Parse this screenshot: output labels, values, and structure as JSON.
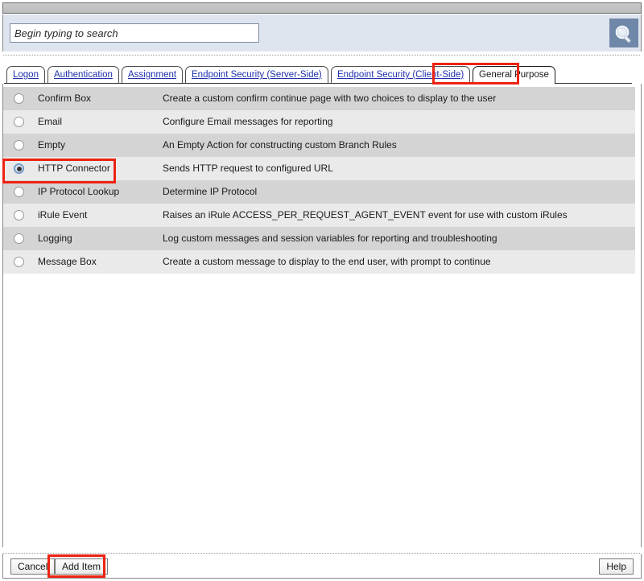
{
  "window": {
    "title_bar": ""
  },
  "search": {
    "placeholder": "Begin typing to search",
    "value": "",
    "button_icon": "search-icon"
  },
  "tabs": [
    {
      "label": "Logon",
      "active": false
    },
    {
      "label": "Authentication",
      "active": false
    },
    {
      "label": "Assignment",
      "active": false
    },
    {
      "label": "Endpoint Security (Server-Side)",
      "active": false
    },
    {
      "label": "Endpoint Security (Client-Side)",
      "active": false
    },
    {
      "label": "General Purpose",
      "active": true
    }
  ],
  "items": [
    {
      "name": "Confirm Box",
      "description": "Create a custom confirm continue page with two choices to display to the user",
      "selected": false
    },
    {
      "name": "Email",
      "description": "Configure Email messages for reporting",
      "selected": false
    },
    {
      "name": "Empty",
      "description": "An Empty Action for constructing custom Branch Rules",
      "selected": false
    },
    {
      "name": "HTTP Connector",
      "description": "Sends HTTP request to configured URL",
      "selected": true
    },
    {
      "name": "IP Protocol Lookup",
      "description": "Determine IP Protocol",
      "selected": false
    },
    {
      "name": "iRule Event",
      "description": "Raises an iRule ACCESS_PER_REQUEST_AGENT_EVENT event for use with custom iRules",
      "selected": false
    },
    {
      "name": "Logging",
      "description": "Log custom messages and session variables for reporting and troubleshooting",
      "selected": false
    },
    {
      "name": "Message Box",
      "description": "Create a custom message to display to the end user, with prompt to continue",
      "selected": false
    }
  ],
  "buttons": {
    "cancel": "Cancel",
    "add_item": "Add Item",
    "help": "Help"
  },
  "colors": {
    "annotation": "#ee2211",
    "row_odd": "#d4d4d4",
    "row_even": "#eaeaea",
    "search_band": "#dfe5ee",
    "search_button": "#6f87a8",
    "tab_link": "#1f2fae"
  }
}
